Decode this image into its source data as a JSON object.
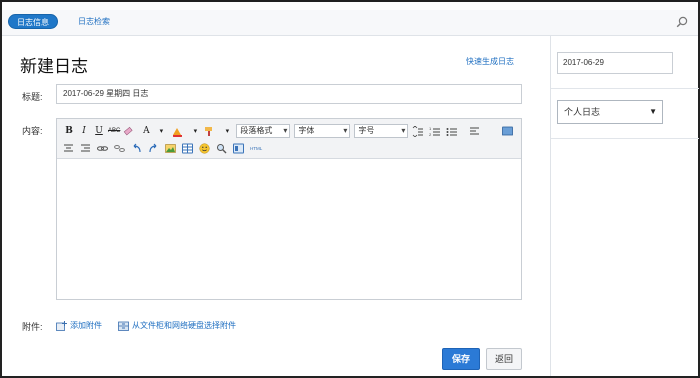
{
  "tabs": {
    "active": "日志信息",
    "second": "日志检索"
  },
  "page": {
    "title": "新建日志",
    "quick_link": "快速生成日志"
  },
  "form": {
    "subject_label": "标题:",
    "subject_value": "2017-06-29 星期四 日志",
    "content_label": "内容:",
    "attachment_label": "附件:",
    "add_attachment": "添加附件",
    "select_from_storage": "从文件柜和网络硬盘选择附件"
  },
  "toolbar": {
    "bold": "B",
    "italic": "I",
    "underline": "U",
    "strike": "ABC",
    "font_color": "A",
    "paragraph_select": "段落格式",
    "font_select": "字体",
    "size_select": "字号"
  },
  "buttons": {
    "save": "保存",
    "back": "返回"
  },
  "sidebar": {
    "date_value": "2017-06-29",
    "log_type": "个人日志"
  },
  "colors": {
    "accent": "#2b7ad6",
    "link": "#1f6fc1"
  }
}
